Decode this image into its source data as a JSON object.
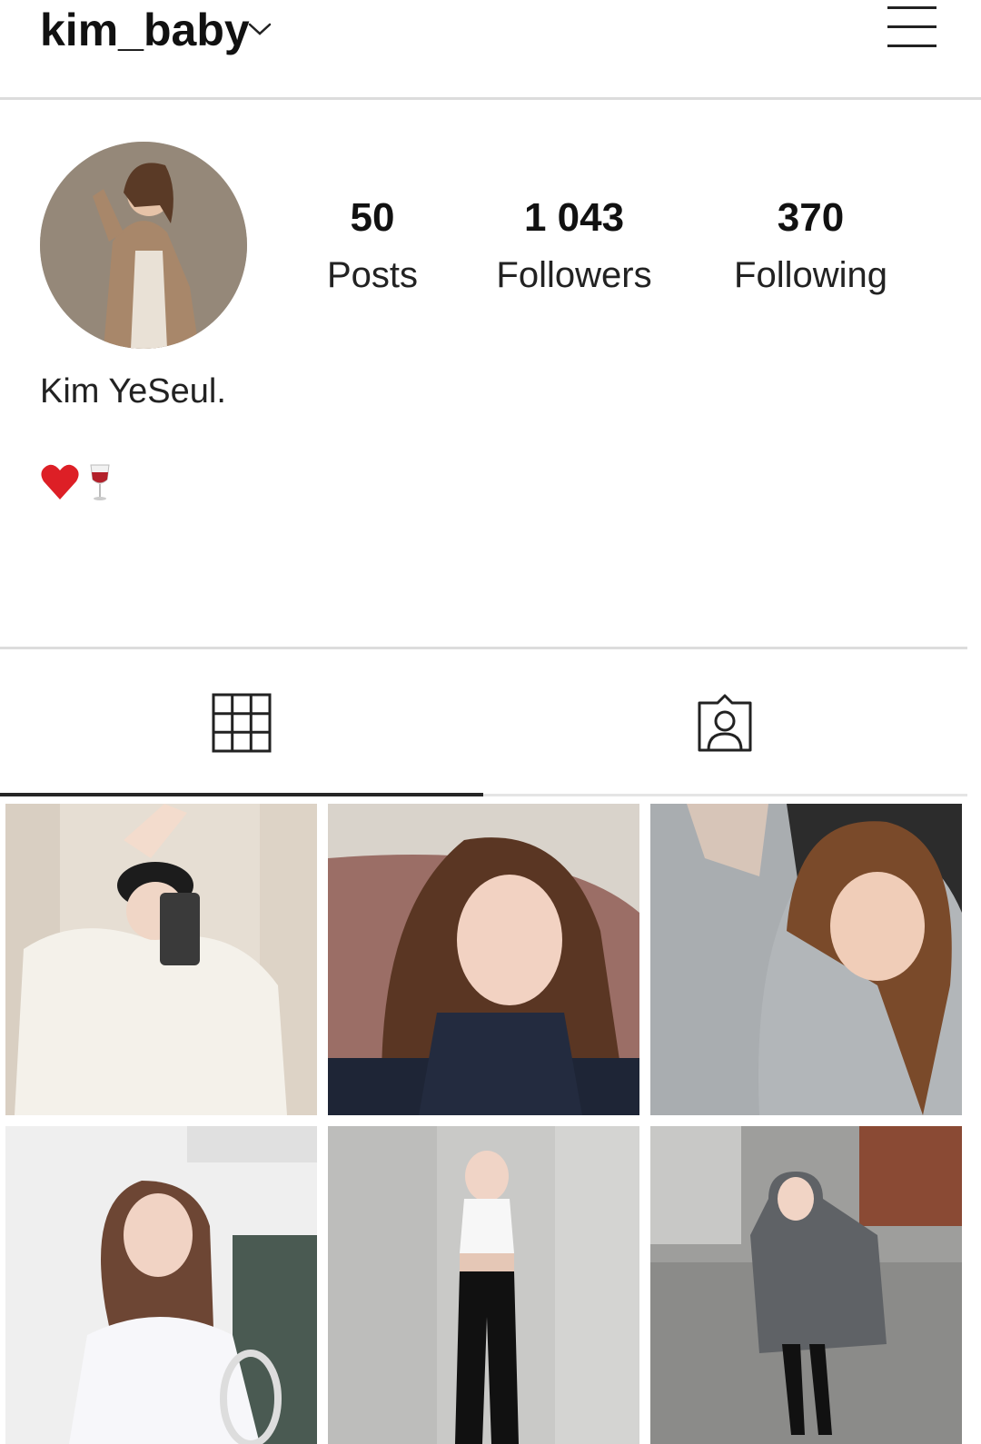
{
  "header": {
    "username": "kim_baby",
    "icons": [
      "chevron-down-icon",
      "hamburger-menu-icon"
    ]
  },
  "profile": {
    "full_name": "Kim YeSeul.",
    "bio_emojis": [
      "red-heart",
      "wine-glass"
    ],
    "stats": [
      {
        "value": "50",
        "label": "Posts"
      },
      {
        "value": "1 043",
        "label": "Followers"
      },
      {
        "value": "370",
        "label": "Following"
      }
    ]
  },
  "tabs": [
    {
      "name": "grid",
      "icon": "grid-icon",
      "active": true
    },
    {
      "name": "tagged",
      "icon": "tagged-person-icon",
      "active": false
    }
  ],
  "posts": [
    {
      "description": "mirror selfie in white knit sweater and black cap"
    },
    {
      "description": "close-up selfie lying on pillow"
    },
    {
      "description": "selfie leaning on shoulder in grey coat"
    },
    {
      "description": "posing in white off-shoulder top at cafe"
    },
    {
      "description": "full-body mirror pose in crop top and black pants"
    },
    {
      "description": "street photo in grey puffer jacket"
    }
  ]
}
